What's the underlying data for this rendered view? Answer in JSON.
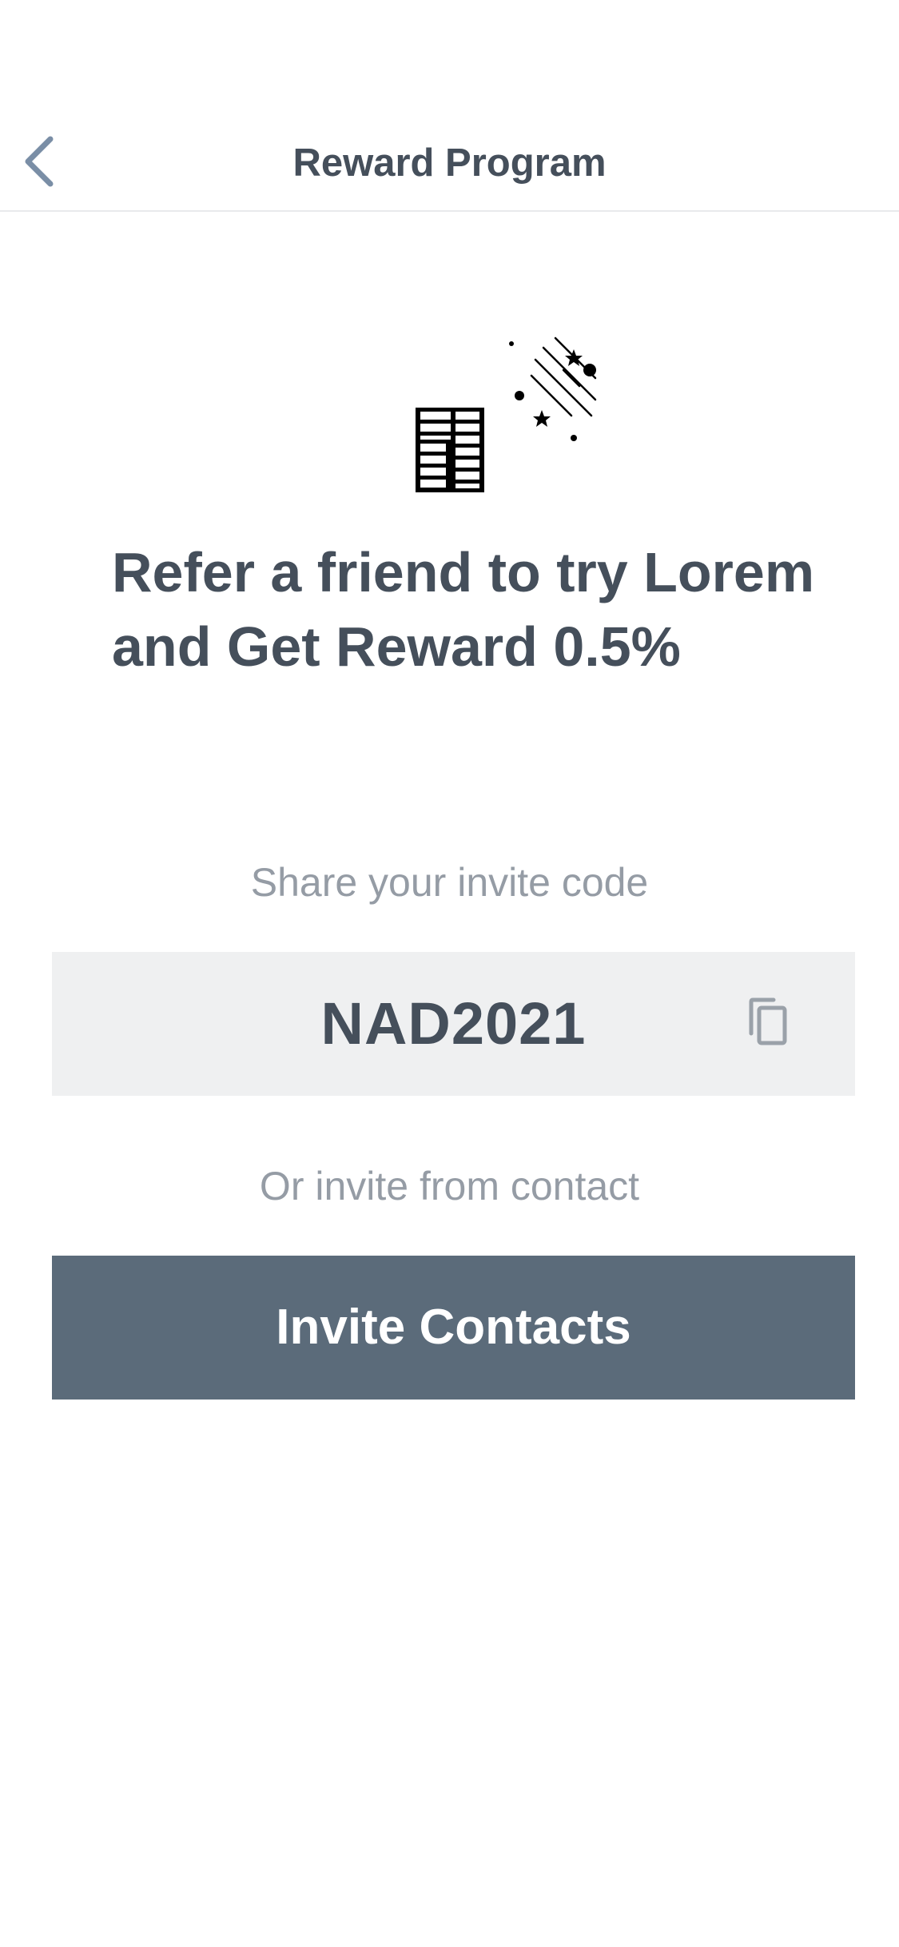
{
  "nav": {
    "title": "Reward Program",
    "back_icon": "chevron-left-icon"
  },
  "hero": {
    "illustration_icons": [
      "coin-stack-icon",
      "shooting-stars-icon"
    ],
    "headline_line1": "Refer a friend to try Lorem",
    "headline_line2": "and Get Reward 0.5%"
  },
  "share": {
    "label": "Share your invite code",
    "code": "NAD2021",
    "copy_icon": "copy-icon"
  },
  "invite": {
    "or_label": "Or invite from contact",
    "button_label": "Invite Contacts"
  },
  "colors": {
    "text_primary": "#454f5b",
    "text_secondary": "#959ca5",
    "accent_back": "#7a8ea6",
    "code_box_bg": "#eff0f1",
    "button_bg": "#5b6b7a",
    "button_text": "#ffffff"
  }
}
